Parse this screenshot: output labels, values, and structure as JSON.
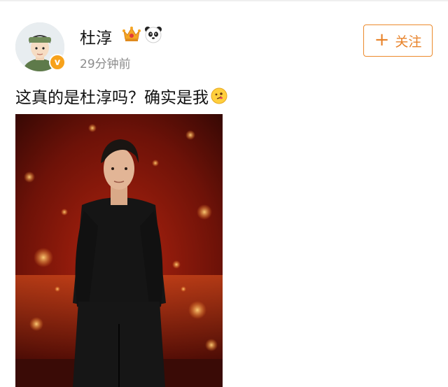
{
  "post": {
    "username": "杜淳",
    "timestamp": "29分钟前",
    "follow_label": "关注",
    "follow_plus": "+",
    "text": "这真的是杜淳吗？确实是我",
    "verified_mark": "v"
  },
  "icons": {
    "crown_badge": "crown-icon",
    "panda_badge": "panda-icon",
    "emoji": "smile-emoji-icon"
  },
  "colors": {
    "accent": "#e8832a",
    "verified": "#f7a21b",
    "timestamp": "#8c8c8c"
  }
}
